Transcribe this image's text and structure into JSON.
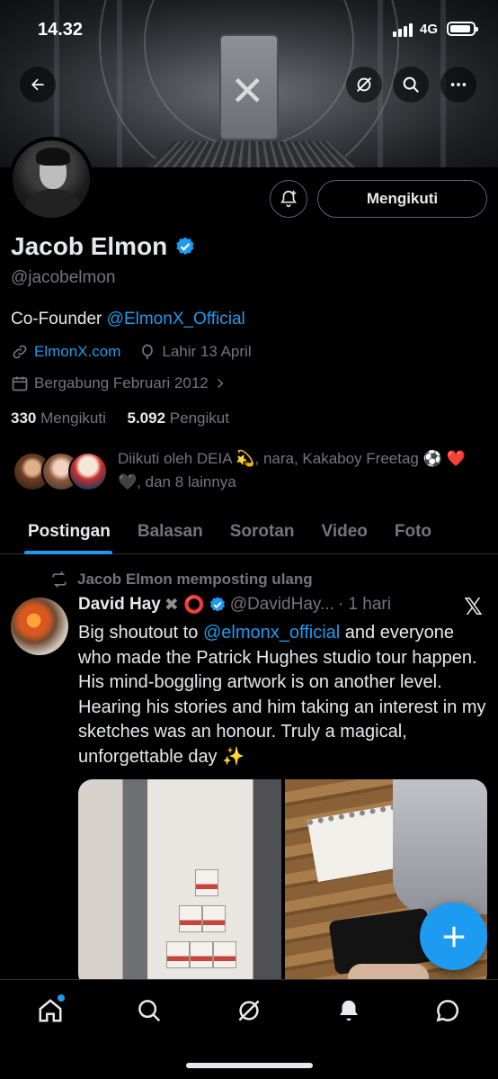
{
  "status_bar": {
    "time": "14.32",
    "network": "4G"
  },
  "profile": {
    "name": "Jacob Elmon",
    "handle": "@jacobelmon",
    "bio_prefix": "Co-Founder ",
    "bio_mention": "@ElmonX_Official",
    "website": "ElmonX.com",
    "birthday": "Lahir 13 April",
    "joined": "Bergabung Februari 2012",
    "following_count": "330",
    "following_label": "Mengikuti",
    "followers_count": "5.092",
    "followers_label": "Pengikut",
    "followed_by_text": "Diikuti oleh DEIA 💫, nara, Kakaboy Freetag ⚽ ❤️🖤, dan 8 lainnya",
    "follow_button_label": "Mengikuti"
  },
  "tabs": [
    {
      "label": "Postingan",
      "active": true
    },
    {
      "label": "Balasan",
      "active": false
    },
    {
      "label": "Sorotan",
      "active": false
    },
    {
      "label": "Video",
      "active": false
    },
    {
      "label": "Foto",
      "active": false
    }
  ],
  "post": {
    "repost_label": "Jacob Elmon memposting ulang",
    "author": "David Hay",
    "author_badges": "✖ ⭕",
    "author_handle": "@DavidHay...",
    "time": "· 1 hari",
    "text_before": "Big shoutout to ",
    "mention": "@elmonx_official",
    "text_after": " and everyone who made the Patrick Hughes studio tour happen. His mind-boggling artwork is on another level. Hearing his stories and him taking an interest in my sketches was an honour. Truly a magical, unforgettable day ✨",
    "source_logo": "𝕏"
  },
  "colors": {
    "accent": "#1d9bf0",
    "muted": "#71767b",
    "text": "#e7e9ea",
    "background": "#000000"
  }
}
